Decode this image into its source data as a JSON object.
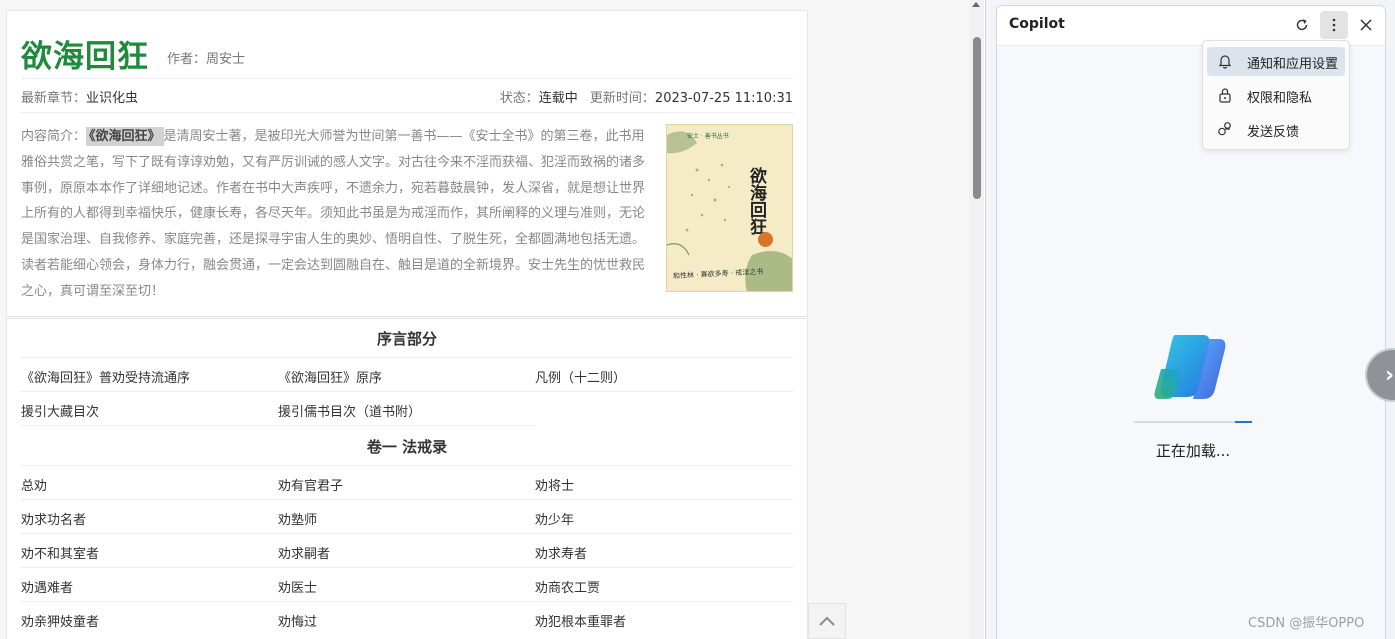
{
  "book": {
    "title": "欲海回狂",
    "author_label": "作者：",
    "author": "周安士",
    "latest_label": "最新章节：",
    "latest_chapter": "业识化虫",
    "status_label": "状态：",
    "status": "连载中",
    "updated_label": "更新时间：",
    "updated": "2023-07-25 11:10:31",
    "intro_label": "内容简介：",
    "intro_highlight": "《欲海回狂》",
    "intro_text": "是清周安士著，是被印光大师誉为世间第一善书——《安士全书》的第三卷，此书用雅俗共赏之笔，写下了既有谆谆劝勉，又有严厉训诫的感人文字。对古往今来不淫而获福、犯淫而致祸的诸多事例，原原本本作了详细地记述。作者在书中大声疾呼，不遗余力，宛若暮鼓晨钟，发人深省，就是想让世界上所有的人都得到幸福快乐，健康长寿，各尽天年。须知此书虽是为戒淫而作，其所阐释的义理与准则，无论是国家治理、自我修养、家庭完善，还是探寻宇宙人生的奥妙、悟明自性、了脱生死，全都圆满地包括无遗。读者若能细心领会，身体力行，融会贯通，一定会达到圆融自在、触目是道的全新境界。安士先生的忧世救民之心，真可谓至深至切！",
    "cover": {
      "title": "欲海回狂",
      "top_text": "安士 · 善书丛书",
      "bottom_text": "和性林 · 寡欲多寿 · 戒淫之书"
    }
  },
  "sections": [
    {
      "title": "序言部分",
      "rows": [
        [
          "《欲海回狂》普劝受持流通序",
          "《欲海回狂》原序",
          "凡例（十二则）"
        ],
        [
          "援引大藏目次",
          "援引儒书目次（道书附）",
          ""
        ]
      ]
    },
    {
      "title": "卷一 法戒录",
      "rows": [
        [
          "总劝",
          "劝有官君子",
          "劝将士"
        ],
        [
          "劝求功名者",
          "劝塾师",
          "劝少年"
        ],
        [
          "劝不和其室者",
          "劝求嗣者",
          "劝求寿者"
        ],
        [
          "劝遇难者",
          "劝医士",
          "劝商农工贾"
        ],
        [
          "劝亲狎妓童者",
          "劝悔过",
          "劝犯根本重罪者"
        ]
      ]
    }
  ],
  "copilot": {
    "title": "Copilot",
    "menu": [
      {
        "label": "通知和应用设置",
        "icon": "bell-icon"
      },
      {
        "label": "权限和隐私",
        "icon": "lock-icon"
      },
      {
        "label": "发送反馈",
        "icon": "feedback-icon"
      }
    ],
    "loading_text": "正在加载...",
    "progress": 0.86
  },
  "watermark": "CSDN @振华OPPO"
}
